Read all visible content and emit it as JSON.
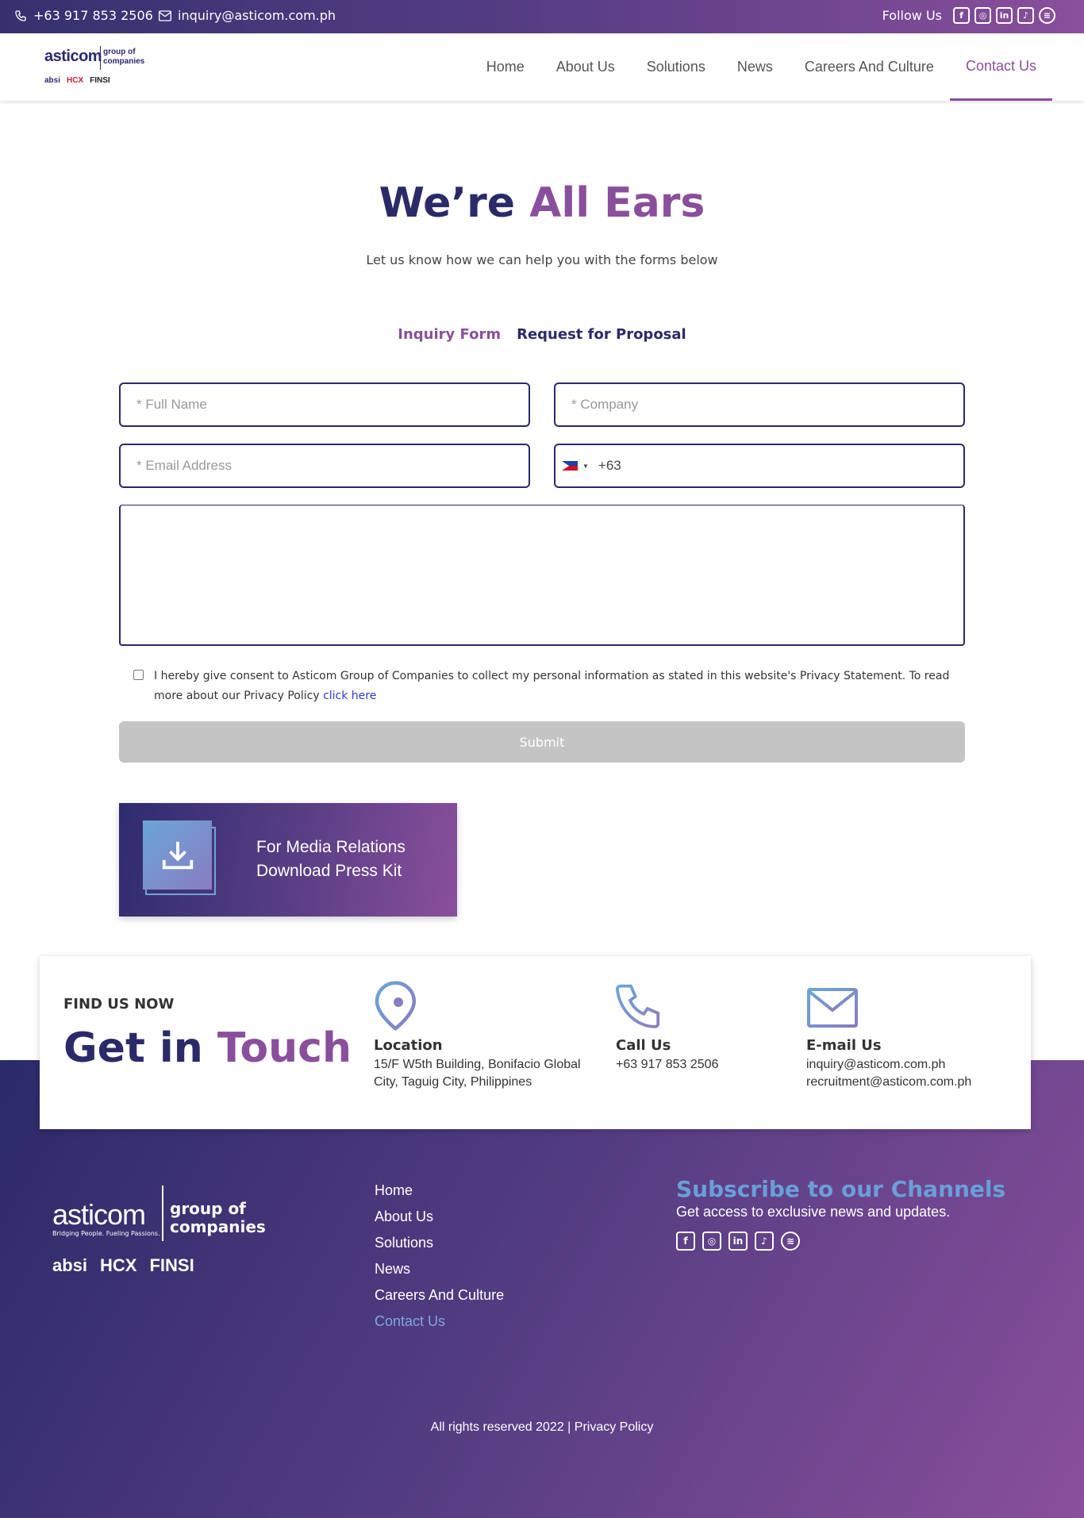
{
  "topbar": {
    "phone": "+63 917 853 2506",
    "email": "inquiry@asticom.com.ph",
    "follow_label": "Follow Us",
    "social_icons": [
      "facebook-icon",
      "instagram-icon",
      "linkedin-icon",
      "tiktok-icon",
      "spotify-icon"
    ]
  },
  "nav": {
    "logo": {
      "word": "asticom",
      "group": "group of",
      "companies": "companies",
      "subs": [
        "absi",
        "HCX",
        "FINSI"
      ]
    },
    "links": [
      "Home",
      "About Us",
      "Solutions",
      "News",
      "Careers And Culture",
      "Contact Us"
    ],
    "active": "Contact Us"
  },
  "hero": {
    "title_main": "We’re ",
    "title_accent": "All Ears",
    "subtitle": "Let us know how we can help you with the forms below"
  },
  "tabs": [
    {
      "label": "Inquiry Form",
      "active": true
    },
    {
      "label": "Request for Proposal",
      "active": false
    }
  ],
  "form": {
    "full_name_placeholder": "* Full Name",
    "company_placeholder": "* Company",
    "email_placeholder": "* Email Address",
    "phone_code": "+63",
    "consent_text": "I hereby give consent to Asticom Group of Companies to collect my personal information as stated in this website's Privacy Statement. To read more about our Privacy Policy ",
    "consent_link": "click here",
    "submit_label": "Submit"
  },
  "press_kit": {
    "line1": "For Media Relations",
    "line2": "Download Press Kit"
  },
  "touch": {
    "kicker": "FIND US NOW",
    "title_main": "Get in ",
    "title_accent": "Touch",
    "location_title": "Location",
    "location_line1": "15/F W5th Building, Bonifacio Global",
    "location_line2": "City, Taguig City, Philippines",
    "call_title": "Call Us",
    "call_value": "+63 917 853 2506",
    "email_title": "E-mail Us",
    "email_value1": "inquiry@asticom.com.ph",
    "email_value2": "recruitment@asticom.com.ph"
  },
  "footer": {
    "logo": {
      "word": "asticom",
      "tagline": "Bridging People. Fueling Passions.",
      "group": "group of",
      "companies": "companies",
      "subs": [
        "absi",
        "HCX",
        "FINSI"
      ]
    },
    "links": [
      "Home",
      "About Us",
      "Solutions",
      "News",
      "Careers And Culture",
      "Contact Us"
    ],
    "subscribe_title": "Subscribe to our Channels",
    "subscribe_text": "Get access to exclusive news and updates.",
    "copyright": "All rights reserved 2022 | Privacy Policy"
  },
  "colors": {
    "navy": "#2b2a69",
    "purple": "#8a4f9c",
    "accent_blue": "#6a9fd8"
  }
}
